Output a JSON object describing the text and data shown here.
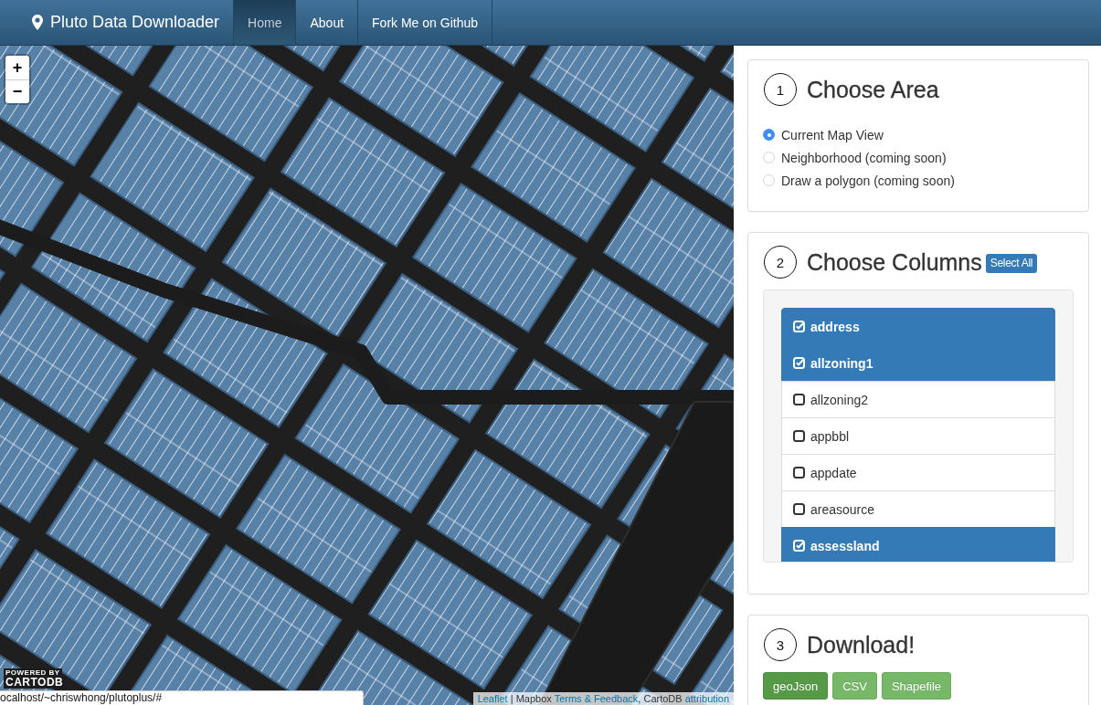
{
  "navbar": {
    "brand": "Pluto Data Downloader",
    "items": [
      {
        "label": "Home",
        "selected": true
      },
      {
        "label": "About",
        "selected": false
      },
      {
        "label": "Fork Me on Github",
        "selected": false
      }
    ]
  },
  "map": {
    "zoom_controls": [
      "+",
      "−"
    ],
    "logo": {
      "tagline": "POWERED BY",
      "name": "CARTODB"
    },
    "attribution": [
      {
        "kind": "link",
        "text": "Leaflet"
      },
      {
        "kind": "text",
        "text": " | Mapbox "
      },
      {
        "kind": "link",
        "text": "Terms & Feedback"
      },
      {
        "kind": "text",
        "text": ", CartoDB "
      },
      {
        "kind": "link",
        "text": "attribution"
      }
    ]
  },
  "panels": [
    {
      "kind": "choose_area",
      "step": "1",
      "title": "Choose Area",
      "options": [
        {
          "label": "Current Map View",
          "selected": true
        },
        {
          "label": "Neighborhood (coming soon)",
          "selected": false
        },
        {
          "label": "Draw a polygon (coming soon)",
          "selected": false
        }
      ]
    },
    {
      "kind": "choose_columns",
      "step": "2",
      "title": "Choose Columns",
      "action": "Select All",
      "columns": [
        {
          "label": "address",
          "checked": true
        },
        {
          "label": "allzoning1",
          "checked": true
        },
        {
          "label": "allzoning2",
          "checked": false
        },
        {
          "label": "appbbl",
          "checked": false
        },
        {
          "label": "appdate",
          "checked": false
        },
        {
          "label": "areasource",
          "checked": false
        },
        {
          "label": "assessland",
          "checked": true
        }
      ]
    },
    {
      "kind": "download",
      "step": "3",
      "title": "Download!",
      "buttons": [
        {
          "label": "geoJson",
          "active": true
        },
        {
          "label": "CSV",
          "active": false
        },
        {
          "label": "Shapefile",
          "active": false
        }
      ]
    }
  ],
  "status_bar": {
    "url": "ocalhost/~chriswhong/plutoplus/#"
  }
}
